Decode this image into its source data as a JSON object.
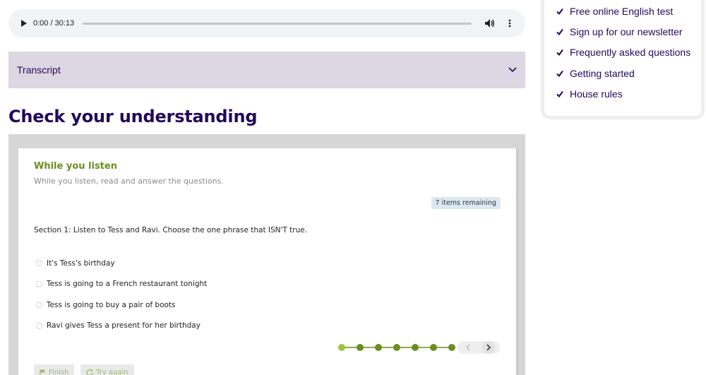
{
  "audio": {
    "time_label": "0:00 / 30:13",
    "progress": 0
  },
  "transcript": {
    "label": "Transcript"
  },
  "section_heading": "Check your understanding",
  "sidebar": {
    "links": [
      {
        "label": "Free online English test"
      },
      {
        "label": "Sign up for our newsletter"
      },
      {
        "label": "Frequently asked questions"
      },
      {
        "label": "Getting started"
      },
      {
        "label": "House rules"
      }
    ]
  },
  "quiz": {
    "title": "While you listen",
    "subtitle": "While you listen, read and answer the questions.",
    "remaining_badge": "7 items remaining",
    "question": "Section 1: Listen to Tess and Ravi. Choose the one phrase that ISN'T true.",
    "options": [
      {
        "label": "It's Tess's birthday"
      },
      {
        "label": "Tess is going to a French restaurant tonight"
      },
      {
        "label": "Tess is going to buy a pair of boots"
      },
      {
        "label": "Ravi gives Tess a present for her birthday"
      }
    ],
    "progress_dots": 7,
    "current_dot": 1,
    "finish_label": "Finish",
    "retry_label": "Try again"
  },
  "colors": {
    "brand_purple": "#23085a",
    "accent_green": "#6b8e1e",
    "dot_green": "#6b8e1e",
    "dot_current": "#9cc33a",
    "transcript_bg": "#ddd6e3"
  }
}
